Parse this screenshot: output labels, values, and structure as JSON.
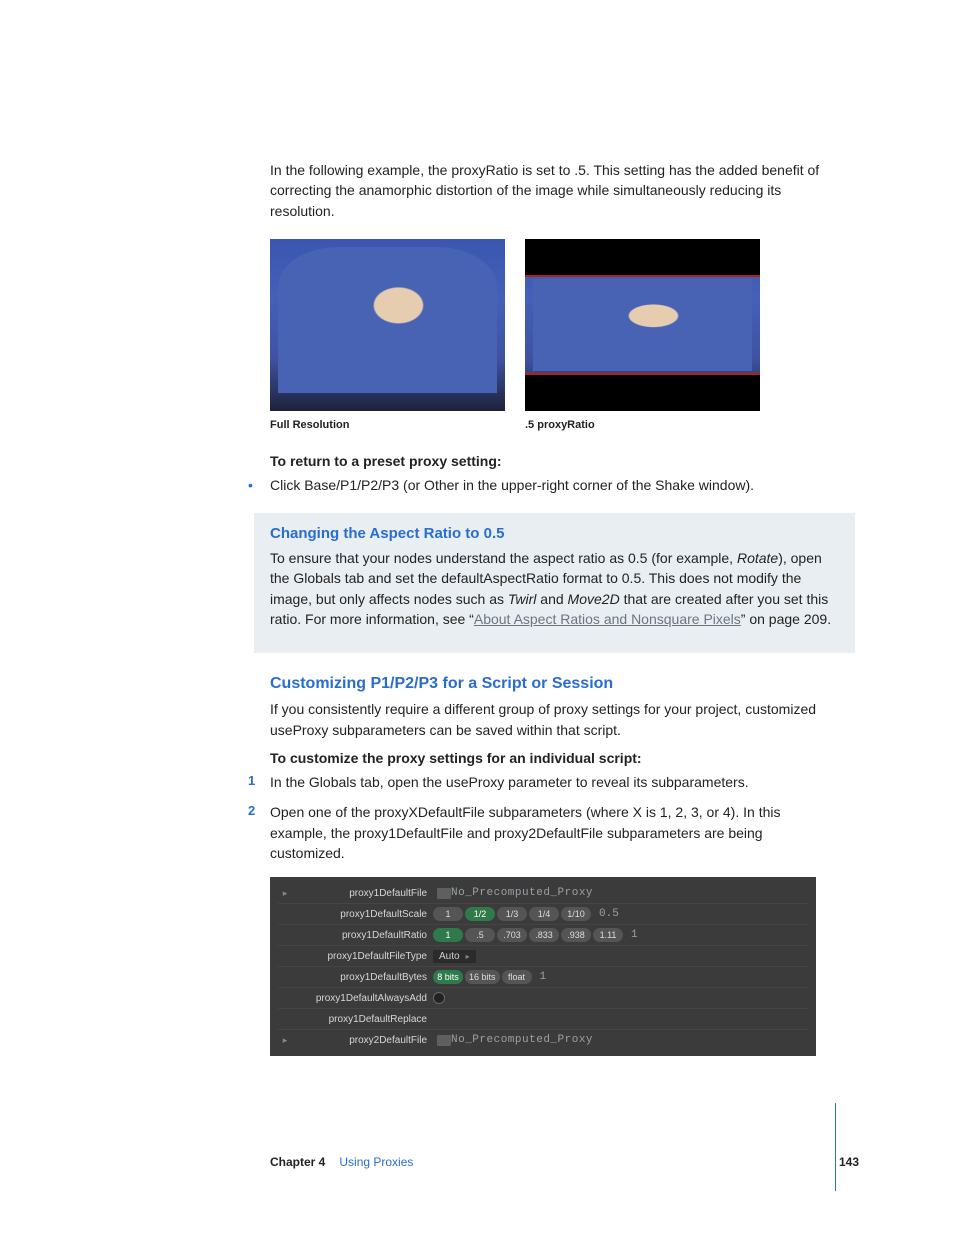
{
  "intro": "In the following example, the proxyRatio is set to .5. This setting has the added benefit of correcting the anamorphic distortion of the image while simultaneously reducing its resolution.",
  "figcaptions": {
    "left": "Full Resolution",
    "right": ".5 proxyRatio"
  },
  "return_heading": "To return to a preset proxy setting:",
  "return_bullet": "Click Base/P1/P2/P3 (or Other in the upper-right corner of the Shake window).",
  "callout": {
    "title": "Changing the Aspect Ratio to 0.5",
    "body_a": "To ensure that your nodes understand the aspect ratio as 0.5 (for example, ",
    "body_a_em": "Rotate",
    "body_a_tail": "), open the Globals tab and set the defaultAspectRatio format to 0.5. This does not modify the image, but only affects nodes such as ",
    "body_b_em1": "Twirl",
    "body_b_mid": " and ",
    "body_b_em2": "Move2D",
    "body_b_tail": " that are created after you set this ratio. For more information, see “",
    "link": "About Aspect Ratios and Nonsquare Pixels",
    "body_c": "” on page 209."
  },
  "section2": {
    "title": "Customizing P1/P2/P3 for a Script or Session",
    "para": "If you consistently require a different group of proxy settings for your project, customized useProxy subparameters can be saved within that script.",
    "steps_heading": "To customize the proxy settings for an individual script:",
    "step1": "In the Globals tab, open the useProxy parameter to reveal its subparameters.",
    "step2": "Open one of the proxyXDefaultFile subparameters (where X is 1, 2, 3, or 4). In this example, the proxy1DefaultFile and proxy2DefaultFile subparameters are being customized."
  },
  "ui": {
    "rows": [
      {
        "tree": "▸",
        "label": "proxy1DefaultFile",
        "type": "text",
        "value": "No_Precomputed_Proxy",
        "folder": true
      },
      {
        "tree": "",
        "label": "proxy1DefaultScale",
        "type": "pills",
        "options": [
          "1",
          "1/2",
          "1/3",
          "1/4",
          "1/10"
        ],
        "selected": "1/2",
        "suffix": "0.5"
      },
      {
        "tree": "",
        "label": "proxy1DefaultRatio",
        "type": "pills",
        "options": [
          "1",
          ".5",
          ".703",
          ".833",
          ".938",
          "1.11"
        ],
        "selected": "1",
        "suffix": "1"
      },
      {
        "tree": "",
        "label": "proxy1DefaultFileType",
        "type": "dropdown",
        "value": "Auto"
      },
      {
        "tree": "",
        "label": "proxy1DefaultBytes",
        "type": "pills",
        "options": [
          "8 bits",
          "16 bits",
          "float"
        ],
        "selected": "8 bits",
        "suffix": "1"
      },
      {
        "tree": "",
        "label": "proxy1DefaultAlwaysAdd",
        "type": "radio"
      },
      {
        "tree": "",
        "label": "proxy1DefaultReplace",
        "type": "blank"
      },
      {
        "tree": "▸",
        "label": "proxy2DefaultFile",
        "type": "text",
        "value": "No_Precomputed_Proxy",
        "folder": true
      }
    ]
  },
  "footer": {
    "chapter_label": "Chapter 4",
    "chapter_title": "Using Proxies",
    "page": "143"
  }
}
